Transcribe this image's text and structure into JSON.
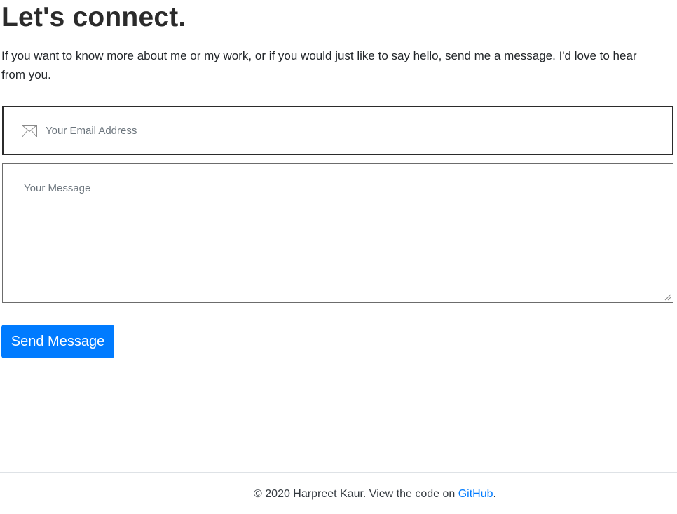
{
  "contact": {
    "heading": "Let's connect.",
    "intro": "If you want to know more about me or my work, or if you would just like to say hello, send me a message. I'd love to hear from you.",
    "email_placeholder": "Your Email Address",
    "email_value": "",
    "email_icon": "envelope-icon",
    "message_placeholder": "Your Message",
    "message_value": "",
    "send_label": "Send Message"
  },
  "footer": {
    "copyright": "© 2020 Harpreet Kaur. View the code on ",
    "link_label": "GitHub",
    "suffix": "."
  },
  "colors": {
    "accent": "#007bff",
    "text": "#212529",
    "border_focused": "#2b2b2b",
    "border": "#6c6c6c"
  }
}
